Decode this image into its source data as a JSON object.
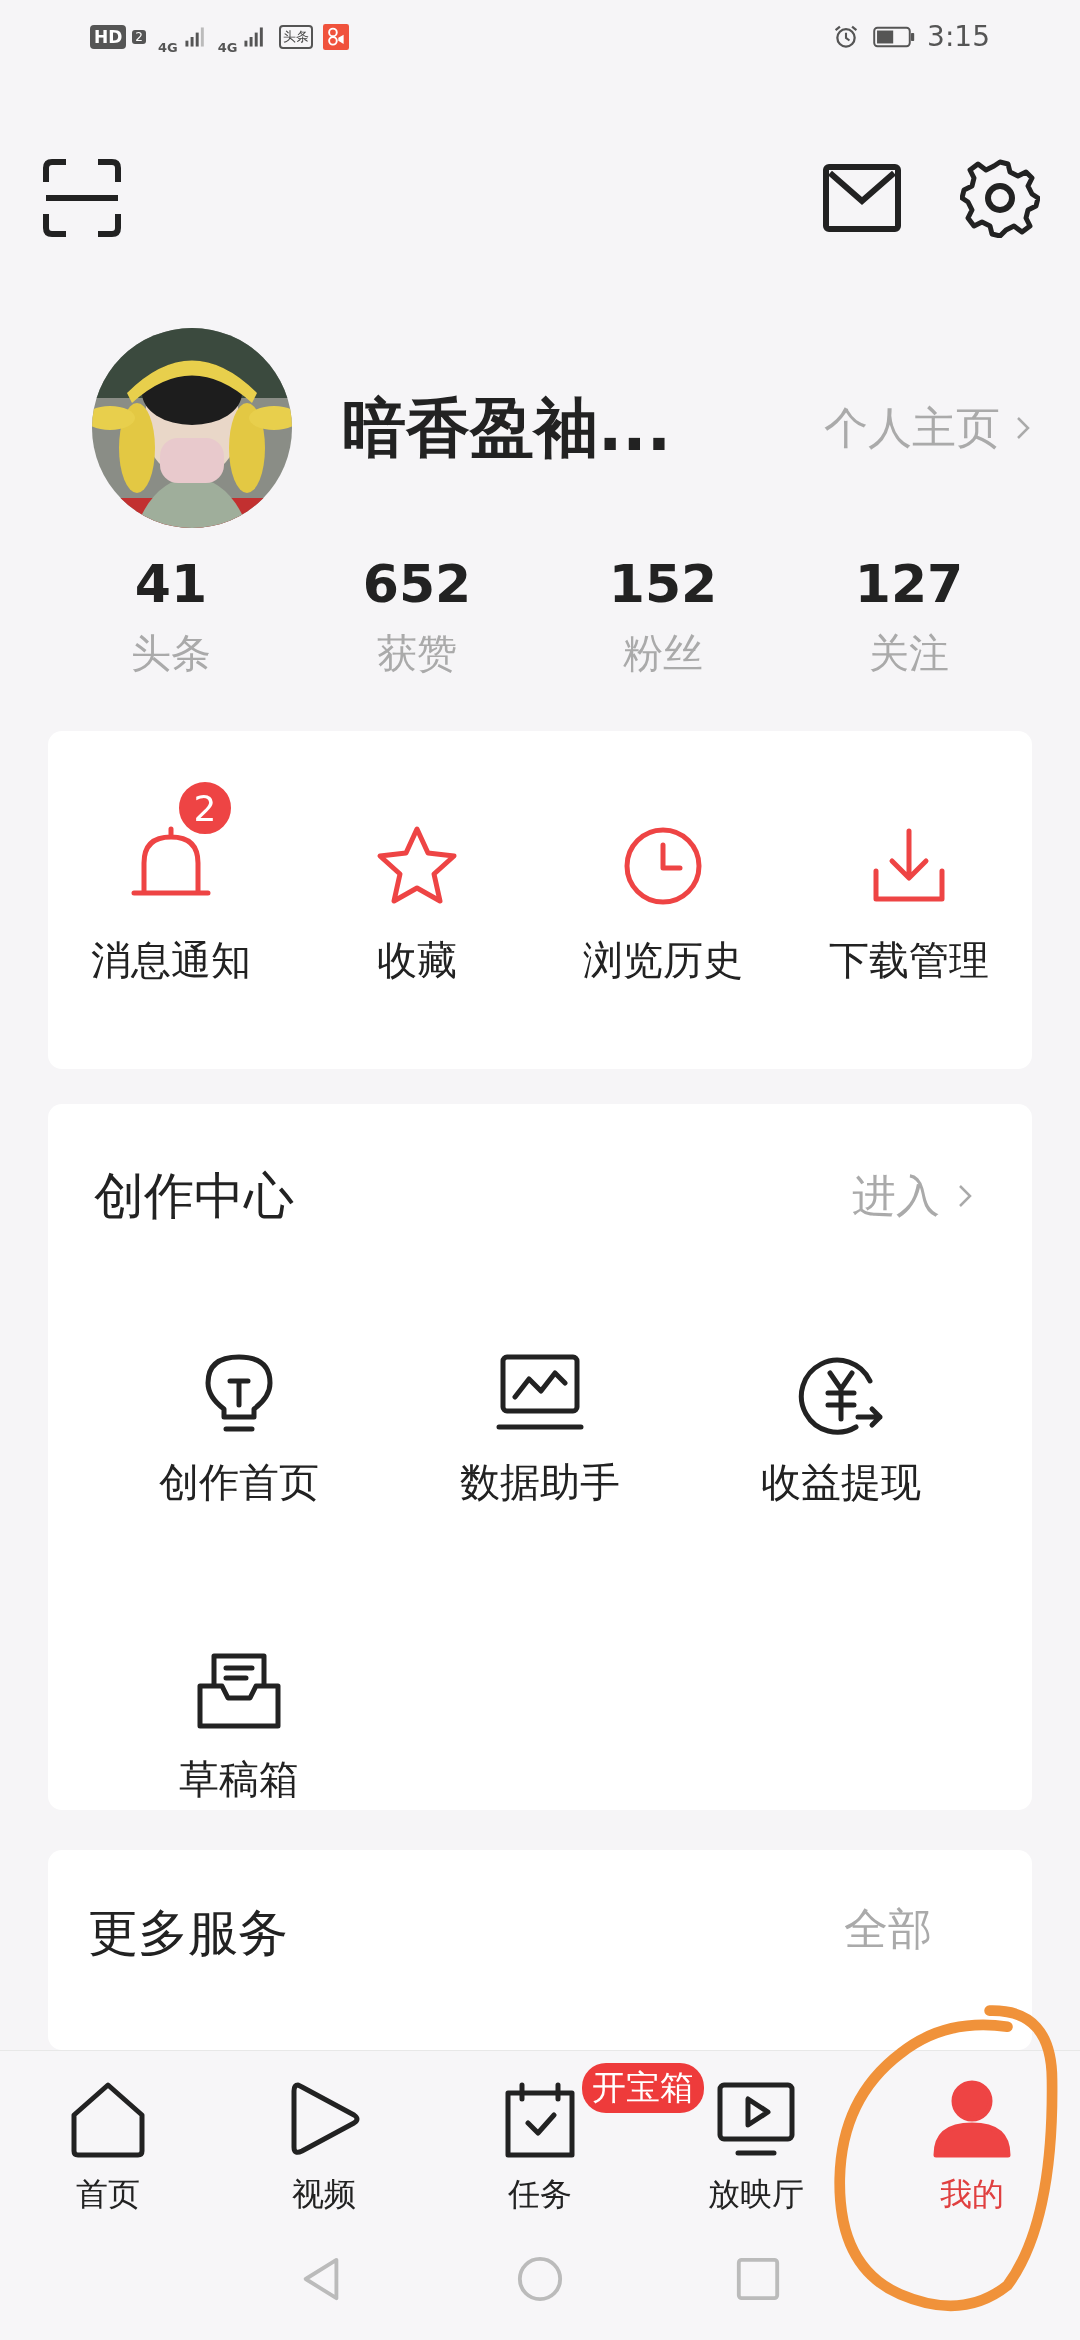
{
  "status_bar": {
    "hd": "HD",
    "sim": "2",
    "network_1": "4G",
    "network_2": "4G",
    "app_badge": "头条",
    "time": "3:15"
  },
  "profile": {
    "name": "暗香盈袖...",
    "homepage_link": "个人主页"
  },
  "stats": [
    {
      "value": "41",
      "label": "头条"
    },
    {
      "value": "652",
      "label": "获赞"
    },
    {
      "value": "152",
      "label": "粉丝"
    },
    {
      "value": "127",
      "label": "关注"
    }
  ],
  "quick_actions": [
    {
      "kind": "bell",
      "label": "消息通知",
      "badge": "2"
    },
    {
      "kind": "star",
      "label": "收藏"
    },
    {
      "kind": "clock",
      "label": "浏览历史"
    },
    {
      "kind": "download",
      "label": "下载管理"
    }
  ],
  "creator_center": {
    "title": "创作中心",
    "enter_link": "进入",
    "tools": [
      {
        "kind": "bulb",
        "label": "创作首页"
      },
      {
        "kind": "chart",
        "label": "数据助手"
      },
      {
        "kind": "yen",
        "label": "收益提现"
      },
      {
        "kind": "draft",
        "label": "草稿箱"
      }
    ]
  },
  "more_services": {
    "title": "更多服务",
    "link": "全部"
  },
  "tab_bar": [
    {
      "kind": "home",
      "label": "首页",
      "selected": false
    },
    {
      "kind": "play",
      "label": "视频",
      "selected": false
    },
    {
      "kind": "task",
      "label": "任务",
      "selected": false,
      "badge": "开宝箱"
    },
    {
      "kind": "tv",
      "label": "放映厅",
      "selected": false
    },
    {
      "kind": "person",
      "label": "我的",
      "selected": true
    }
  ]
}
